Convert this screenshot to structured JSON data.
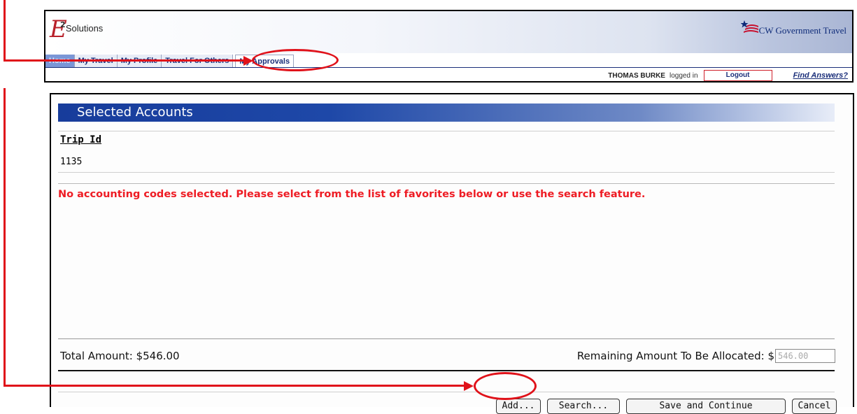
{
  "header": {
    "logo_text": "Solutions",
    "logo_mark": "E",
    "logo_superscript": "2",
    "partner_logo_text": "CW Government Travel",
    "tabs": [
      {
        "label": "Home"
      },
      {
        "label": "My Travel"
      },
      {
        "label": "My Profile"
      },
      {
        "label": "Travel For Others"
      },
      {
        "label": "My Approvals"
      }
    ],
    "user_name": "THOMAS BURKE",
    "logged_in_text": "logged in",
    "logout_label": "Logout",
    "help_link": "Find Answers?"
  },
  "section": {
    "title": "Selected Accounts",
    "trip_id_label": "Trip Id",
    "trip_id_value": "1135",
    "message": "No accounting codes selected. Please select from the list of favorites below or use the search feature.",
    "total_amount": "Total Amount: $546.00",
    "remaining_label": "Remaining Amount To Be Allocated: $",
    "remaining_value": "546.00"
  },
  "buttons": {
    "add": "Add...",
    "search": "Search...",
    "save_continue": "Save and Continue",
    "cancel": "Cancel"
  },
  "colors": {
    "annotation": "#e0121a",
    "header_blue": "#173c9b",
    "warning_text": "#ee1c24"
  }
}
